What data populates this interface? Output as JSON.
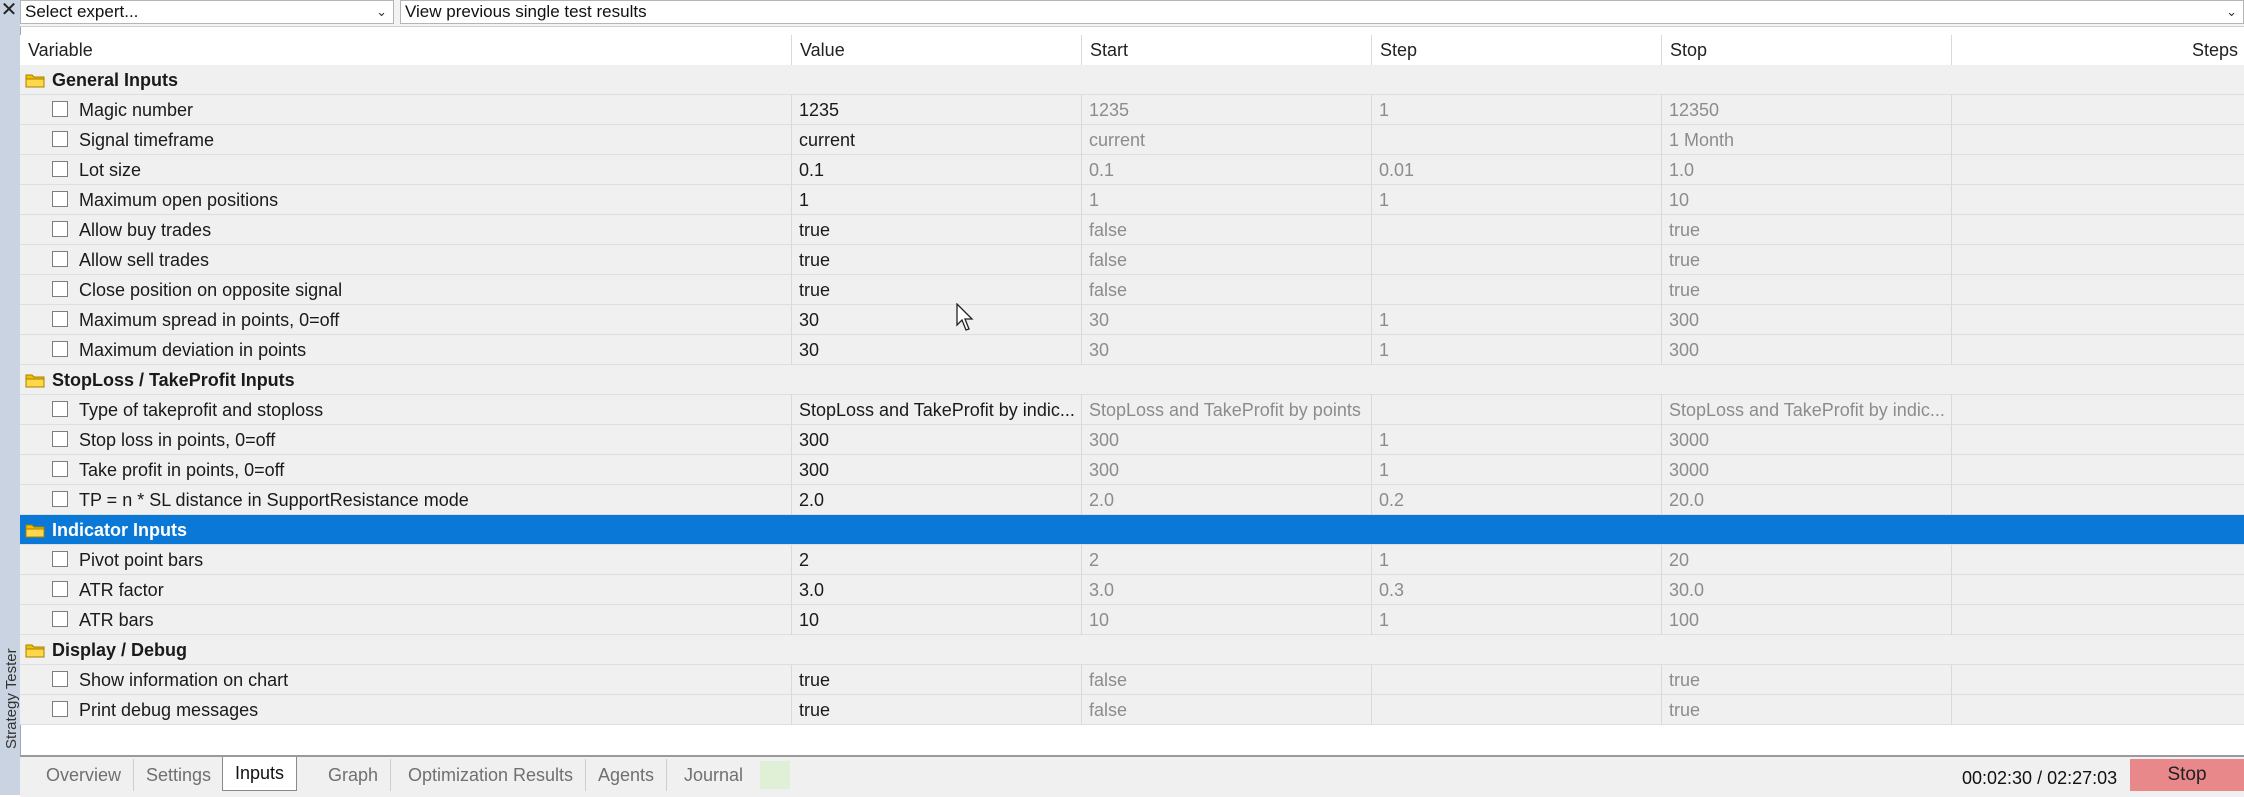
{
  "side": {
    "close_glyph": "✕",
    "label": "Strategy Tester"
  },
  "topbar": {
    "expert_select": "Select expert...",
    "results_select": "View previous single test results"
  },
  "columns": [
    "Variable",
    "Value",
    "Start",
    "Step",
    "Stop",
    "Steps"
  ],
  "rows": [
    {
      "type": "group",
      "label": "General Inputs"
    },
    {
      "type": "param",
      "label": "Magic number",
      "value": "1235",
      "start": "1235",
      "step": "1",
      "stop": "12350"
    },
    {
      "type": "param",
      "label": "Signal timeframe",
      "value": "current",
      "start": "current",
      "step": "",
      "stop": "1 Month"
    },
    {
      "type": "param",
      "label": "Lot size",
      "value": "0.1",
      "start": "0.1",
      "step": "0.01",
      "stop": "1.0"
    },
    {
      "type": "param",
      "label": "Maximum open positions",
      "value": "1",
      "start": "1",
      "step": "1",
      "stop": "10"
    },
    {
      "type": "param",
      "label": "Allow buy trades",
      "value": "true",
      "start": "false",
      "step": "",
      "stop": "true"
    },
    {
      "type": "param",
      "label": "Allow sell trades",
      "value": "true",
      "start": "false",
      "step": "",
      "stop": "true"
    },
    {
      "type": "param",
      "label": "Close position on opposite signal",
      "value": "true",
      "start": "false",
      "step": "",
      "stop": "true"
    },
    {
      "type": "param",
      "label": "Maximum spread in points, 0=off",
      "value": "30",
      "start": "30",
      "step": "1",
      "stop": "300"
    },
    {
      "type": "param",
      "label": "Maximum deviation in points",
      "value": "30",
      "start": "30",
      "step": "1",
      "stop": "300"
    },
    {
      "type": "group",
      "label": "StopLoss / TakeProfit Inputs"
    },
    {
      "type": "param",
      "label": "Type of takeprofit and stoploss",
      "value": "StopLoss and TakeProfit by indic...",
      "start": "StopLoss and TakeProfit by points",
      "step": "",
      "stop": "StopLoss and TakeProfit by indic..."
    },
    {
      "type": "param",
      "label": "Stop loss in points, 0=off",
      "value": "300",
      "start": "300",
      "step": "1",
      "stop": "3000"
    },
    {
      "type": "param",
      "label": "Take profit in points, 0=off",
      "value": "300",
      "start": "300",
      "step": "1",
      "stop": "3000"
    },
    {
      "type": "param",
      "label": "TP = n * SL distance in SupportResistance mode",
      "value": "2.0",
      "start": "2.0",
      "step": "0.2",
      "stop": "20.0"
    },
    {
      "type": "group",
      "label": "Indicator Inputs",
      "selected": true
    },
    {
      "type": "param",
      "label": "Pivot point bars",
      "value": "2",
      "start": "2",
      "step": "1",
      "stop": "20"
    },
    {
      "type": "param",
      "label": "ATR factor",
      "value": "3.0",
      "start": "3.0",
      "step": "0.3",
      "stop": "30.0"
    },
    {
      "type": "param",
      "label": "ATR bars",
      "value": "10",
      "start": "10",
      "step": "1",
      "stop": "100"
    },
    {
      "type": "group",
      "label": "Display / Debug"
    },
    {
      "type": "param",
      "label": "Show information on chart",
      "value": "true",
      "start": "false",
      "step": "",
      "stop": "true"
    },
    {
      "type": "param",
      "label": "Print debug messages",
      "value": "true",
      "start": "false",
      "step": "",
      "stop": "true"
    }
  ],
  "tabs": [
    {
      "label": "Overview",
      "active": false
    },
    {
      "label": "Settings",
      "active": false
    },
    {
      "label": "Inputs",
      "active": true
    },
    {
      "label": "Graph",
      "active": false
    },
    {
      "label": "Optimization Results",
      "active": false
    },
    {
      "label": "Agents",
      "active": false
    },
    {
      "label": "Journal",
      "active": false
    }
  ],
  "status": {
    "timer": "00:02:30 / 02:27:03",
    "stop_label": "Stop"
  },
  "colors": {
    "selected_row": "#0a78d7",
    "stop_button": "#e8888a",
    "folder": "#f2c200"
  }
}
